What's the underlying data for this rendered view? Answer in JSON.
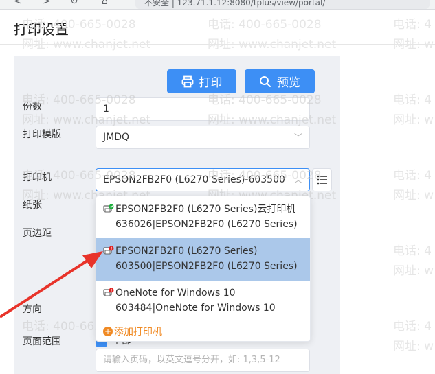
{
  "browser": {
    "url_text": "不安全 | 123.71.1.12:8080/tplus/view/portal/"
  },
  "page": {
    "title": "打印设置"
  },
  "watermark": {
    "phone": "电话: 400-665-0028",
    "site": "网址: www.chanjet.net",
    "phone_partial": "电话: 4",
    "site_partial": "网址: w"
  },
  "actions": {
    "print_label": "打印",
    "preview_label": "预览"
  },
  "form": {
    "copies": {
      "label": "份数",
      "value": "1"
    },
    "template": {
      "label": "打印模版",
      "value": "JMDQ"
    },
    "printer": {
      "label": "打印机",
      "value": "EPSON2FB2F0 (L6270 Series)-603500"
    },
    "paper": {
      "label": "纸张"
    },
    "margin": {
      "label": "页边距"
    },
    "orientation": {
      "label": "方向"
    },
    "page_range": {
      "label": "页面范围",
      "checkbox_label": "全部",
      "placeholder": "请输入页码，以英文逗号分开，如: 1,3,5-12"
    }
  },
  "printer_dropdown": {
    "options": [
      {
        "line1": "EPSON2FB2F0 (L6270 Series)云打印机",
        "line2": "636026|EPSON2FB2F0 (L6270 Series)",
        "status": "online"
      },
      {
        "line1": "EPSON2FB2F0 (L6270 Series)",
        "line2": "603500|EPSON2FB2F0 (L6270 Series)",
        "status": "error"
      },
      {
        "line1": "OneNote for Windows 10",
        "line2": "603484|OneNote for Windows 10",
        "status": "error"
      }
    ],
    "selected_index": 1,
    "add_label": "添加打印机"
  },
  "colors": {
    "primary": "#3d8ff5",
    "selected_bg": "#abc8ea",
    "accent_orange": "#f08a24",
    "error_red": "#e02020",
    "online_green": "#1aad3b",
    "arrow_red": "#e8332a"
  },
  "icons": {
    "print": "printer-icon",
    "preview": "search-icon",
    "list": "list-icon"
  }
}
